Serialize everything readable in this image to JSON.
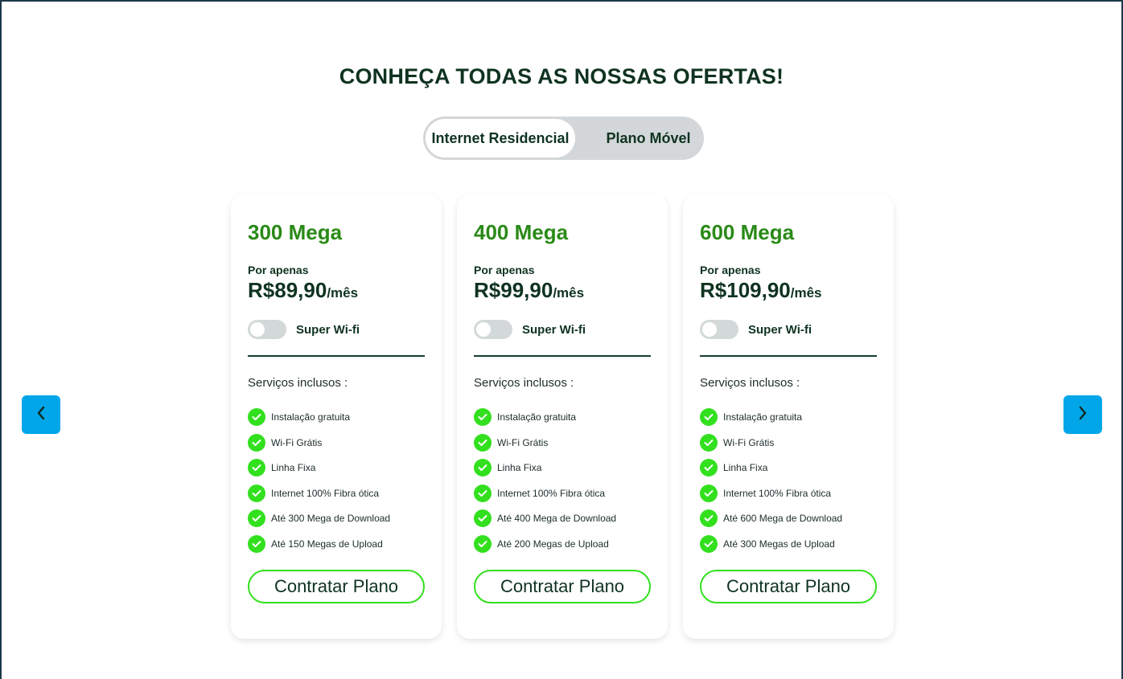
{
  "header": {
    "title": "CONHEÇA TODAS AS NOSSAS OFERTAS!"
  },
  "tabs": [
    {
      "label": "Internet Residencial",
      "active": true
    },
    {
      "label": "Plano Móvel",
      "active": false
    }
  ],
  "carousel": {
    "prev_icon": "chevron-left-icon",
    "next_icon": "chevron-right-icon",
    "accent_color": "#00a6e8"
  },
  "colors": {
    "title_green": "#2a8a17",
    "check_green": "#32e01e",
    "dark_green": "#0f3320"
  },
  "plans": [
    {
      "name": "300 Mega",
      "price_label": "Por apenas",
      "price": "R$89,90",
      "period": "/mês",
      "wifi_label": "Super Wi-fi",
      "wifi_on": false,
      "services_title": "Serviços inclusos :",
      "features": [
        "Instalação gratuita",
        "Wi-Fi Grátis",
        "Linha Fixa",
        "Internet 100% Fibra ótica",
        "Até 300 Mega de Download",
        "Até 150 Megas de Upload"
      ],
      "cta": "Contratar Plano"
    },
    {
      "name": "400 Mega",
      "price_label": "Por apenas",
      "price": "R$99,90",
      "period": "/mês",
      "wifi_label": "Super Wi-fi",
      "wifi_on": false,
      "services_title": "Serviços inclusos :",
      "features": [
        "Instalação gratuita",
        "Wi-Fi Grátis",
        "Linha Fixa",
        "Internet 100% Fibra ótica",
        "Até 400 Mega de Download",
        "Até 200 Megas de Upload"
      ],
      "cta": "Contratar Plano"
    },
    {
      "name": "600 Mega",
      "price_label": "Por apenas",
      "price": "R$109,90",
      "period": "/mês",
      "wifi_label": "Super Wi-fi",
      "wifi_on": false,
      "services_title": "Serviços inclusos :",
      "features": [
        "Instalação gratuita",
        "Wi-Fi Grátis",
        "Linha Fixa",
        "Internet 100% Fibra ótica",
        "Até 600 Mega de Download",
        "Até 300 Megas de Upload"
      ],
      "cta": "Contratar Plano"
    }
  ]
}
